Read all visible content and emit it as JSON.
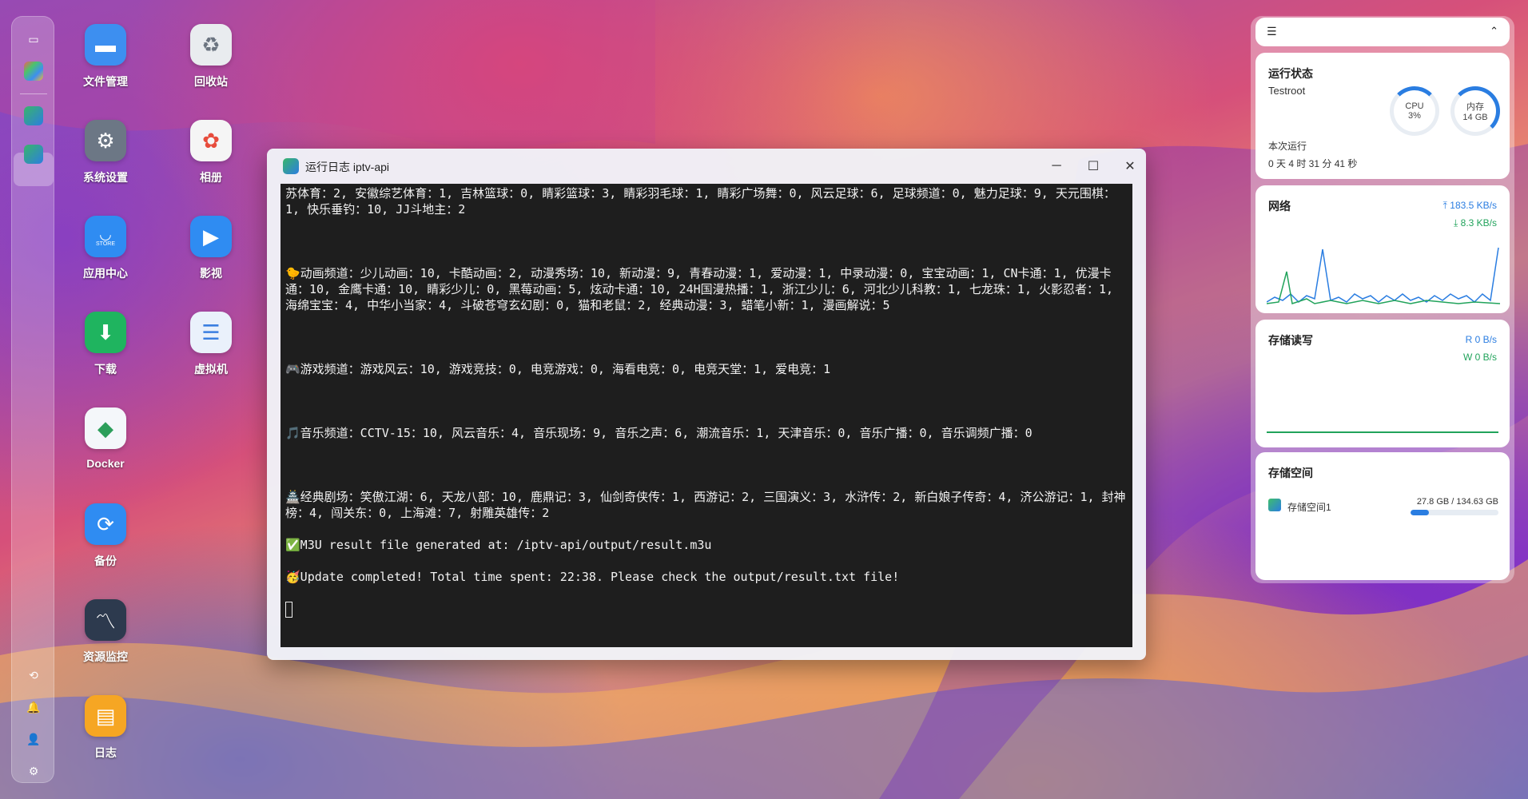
{
  "desktop": {
    "icons": [
      {
        "label": "文件管理",
        "icon": "folder-icon",
        "color": "#3d8ff0"
      },
      {
        "label": "回收站",
        "icon": "recycle-bin-icon",
        "color": "#e9ecef"
      },
      {
        "label": "系统设置",
        "icon": "gear-icon",
        "color": "#6c7785"
      },
      {
        "label": "相册",
        "icon": "photos-icon",
        "color": "#f5f5f5"
      },
      {
        "label": "应用中心",
        "icon": "store-icon",
        "color": "#2f8cf2"
      },
      {
        "label": "影视",
        "icon": "video-icon",
        "color": "#2f8cf2"
      },
      {
        "label": "下载",
        "icon": "download-icon",
        "color": "#1fb45f"
      },
      {
        "label": "虚拟机",
        "icon": "server-icon",
        "color": "#eaf1fb"
      },
      {
        "label": "Docker",
        "icon": "docker-icon",
        "color": "#f4f7fa"
      },
      {
        "label": "备份",
        "icon": "backup-icon",
        "color": "#2f8cf2"
      },
      {
        "label": "资源监控",
        "icon": "monitor-icon",
        "color": "#2d3a4e"
      },
      {
        "label": "日志",
        "icon": "log-icon",
        "color": "#f6a623"
      }
    ],
    "store_badge": "STORE"
  },
  "window": {
    "title": "运行日志 iptv-api",
    "lines": {
      "l1": "苏体育：2, 安徽综艺体育：1, 吉林篮球：0, 睛彩篮球：3, 睛彩羽毛球：1, 睛彩广场舞：0, 风云足球：6, 足球频道：0, 魅力足球：9, 天元围棋：1, 快乐垂钓：10, JJ斗地主：2",
      "l2": "🐤动画频道：少儿动画：10, 卡酷动画：2, 动漫秀场：10, 新动漫：9, 青春动漫：1, 爱动漫：1, 中录动漫：0, 宝宝动画：1, CN卡通：1, 优漫卡通：10, 金鹰卡通：10, 睛彩少儿：0, 黑莓动画：5, 炫动卡通：10, 24H国漫热播：1, 浙江少儿：6, 河北少儿科教：1, 七龙珠：1, 火影忍者：1, 海绵宝宝：4, 中华小当家：4, 斗破苍穹玄幻剧：0, 猫和老鼠：2, 经典动漫：3, 蜡笔小新：1, 漫画解说：5",
      "l3": "🎮游戏频道：游戏风云：10, 游戏竞技：0, 电竞游戏：0, 海看电竞：0, 电竞天堂：1, 爱电竞：1",
      "l4": "🎵音乐频道：CCTV-15：10, 风云音乐：4, 音乐现场：9, 音乐之声：6, 潮流音乐：1, 天津音乐：0, 音乐广播：0, 音乐调频广播：0",
      "l5": "🏯经典剧场：笑傲江湖：6, 天龙八部：10, 鹿鼎记：3, 仙剑奇侠传：1, 西游记：2, 三国演义：3, 水浒传：2, 新白娘子传奇：4, 济公游记：1, 封神榜：4, 闯关东：0, 上海滩：7, 射雕英雄传：2",
      "l6": "✅M3U result file generated at: /iptv-api/output/result.m3u",
      "l7": "🥳Update completed! Total time spent: 22:38. Please check the output/result.txt file!"
    }
  },
  "widgets": {
    "status": {
      "title": "运行状态",
      "host": "Testroot",
      "cpu_label": "CPU",
      "cpu_value": "3%",
      "cpu_percent": 3,
      "mem_label": "内存",
      "mem_value": "14 GB",
      "mem_percent": 12,
      "uptime_label": "本次运行",
      "uptime_value": "0 天 4 时 31 分 41 秒"
    },
    "network": {
      "title": "网络",
      "up": "183.5 KB/s",
      "down": "8.3 KB/s"
    },
    "storage_io": {
      "title": "存储读写",
      "read": "R  0 B/s",
      "write": "W  0 B/s"
    },
    "storage_space": {
      "title": "存储空间",
      "volume": "存储空间1",
      "usage": "27.8 GB / 134.63 GB",
      "used_fraction": 0.206
    }
  },
  "colors": {
    "accent": "#2a7de1",
    "terminal_bg": "#1e1e1e"
  }
}
